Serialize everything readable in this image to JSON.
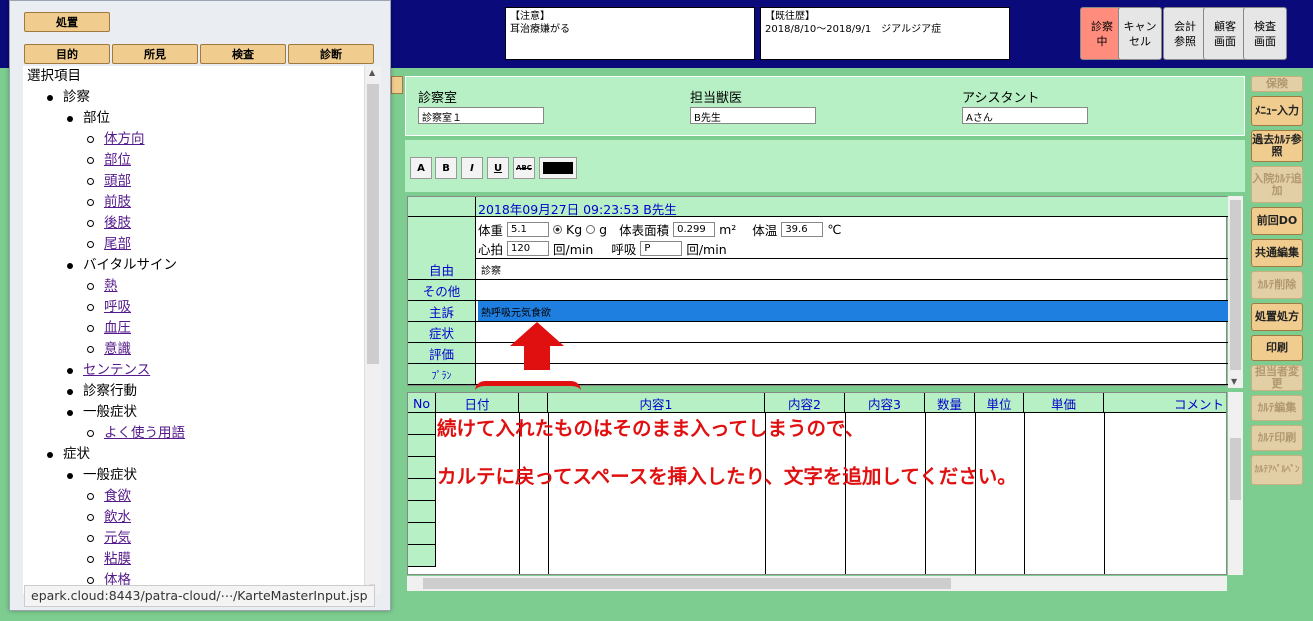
{
  "top": {
    "notice_label": "【注意】",
    "notice_text": "耳治療嫌がる",
    "history_label": "【既往歴】",
    "history_text": "2018/8/10～2018/9/1　ジアルジア症",
    "buttons": [
      "診察中",
      "キャンセル",
      "会計参照",
      "顧客画面",
      "検査画面"
    ]
  },
  "panel": {
    "top_button": "処置",
    "tabs": [
      "目的",
      "所見",
      "検査",
      "診断"
    ],
    "tree_root": "選択項目",
    "tree": [
      {
        "level": 1,
        "bullet": "dot",
        "label": "診察",
        "link": false
      },
      {
        "level": 2,
        "bullet": "dot",
        "label": "部位",
        "link": false
      },
      {
        "level": 3,
        "bullet": "circ",
        "label": "体方向",
        "link": true
      },
      {
        "level": 3,
        "bullet": "circ",
        "label": "部位",
        "link": true
      },
      {
        "level": 3,
        "bullet": "circ",
        "label": "頭部",
        "link": true
      },
      {
        "level": 3,
        "bullet": "circ",
        "label": "前肢",
        "link": true
      },
      {
        "level": 3,
        "bullet": "circ",
        "label": "後肢",
        "link": true
      },
      {
        "level": 3,
        "bullet": "circ",
        "label": "尾部",
        "link": true
      },
      {
        "level": 2,
        "bullet": "dot",
        "label": "バイタルサイン",
        "link": false
      },
      {
        "level": 3,
        "bullet": "circ",
        "label": "熱",
        "link": true
      },
      {
        "level": 3,
        "bullet": "circ",
        "label": "呼吸",
        "link": true
      },
      {
        "level": 3,
        "bullet": "circ",
        "label": "血圧",
        "link": true
      },
      {
        "level": 3,
        "bullet": "circ",
        "label": "意識",
        "link": true
      },
      {
        "level": 2,
        "bullet": "dot",
        "label": "センテンス",
        "link": true
      },
      {
        "level": 2,
        "bullet": "dot",
        "label": "診察行動",
        "link": false
      },
      {
        "level": 2,
        "bullet": "dot",
        "label": "一般症状",
        "link": false
      },
      {
        "level": 3,
        "bullet": "circ",
        "label": "よく使う用語",
        "link": true
      },
      {
        "level": 1,
        "bullet": "dot",
        "label": "症状",
        "link": false
      },
      {
        "level": 2,
        "bullet": "dot",
        "label": "一般症状",
        "link": false
      },
      {
        "level": 3,
        "bullet": "circ",
        "label": "食欲",
        "link": true
      },
      {
        "level": 3,
        "bullet": "circ",
        "label": "飲水",
        "link": true
      },
      {
        "level": 3,
        "bullet": "circ",
        "label": "元気",
        "link": true
      },
      {
        "level": 3,
        "bullet": "circ",
        "label": "粘膜",
        "link": true
      },
      {
        "level": 3,
        "bullet": "circ",
        "label": "体格",
        "link": true
      }
    ],
    "status_url": "epark.cloud:8443/patra-cloud/⋯/KarteMasterInput.jsp"
  },
  "form": {
    "room_label": "診察室",
    "room_value": "診察室１",
    "doctor_label": "担当獣医",
    "doctor_value": "B先生",
    "assistant_label": "アシスタント",
    "assistant_value": "Aさん"
  },
  "format_buttons": [
    "A",
    "B",
    "I",
    "U",
    "ABC"
  ],
  "karte": {
    "header": "2018年09月27日 09:23:53 B先生",
    "weight_label": "体重",
    "weight_value": "5.1",
    "unit_kg": "Kg",
    "unit_g": "g",
    "bsa_label": "体表面積",
    "bsa_value": "0.299",
    "bsa_unit": "m²",
    "temp_label": "体温",
    "temp_value": "39.6",
    "temp_unit": "℃",
    "pulse_label": "心拍",
    "pulse_value": "120",
    "pulse_unit": "回/min",
    "resp_label": "呼吸",
    "resp_value": "P",
    "resp_unit": "回/min",
    "rows": [
      {
        "label": "自由",
        "value": "診察"
      },
      {
        "label": "その他",
        "value": ""
      },
      {
        "label": "主訴",
        "value": "熱呼吸元気食欲"
      },
      {
        "label": "症状",
        "value": ""
      },
      {
        "label": "評価",
        "value": ""
      },
      {
        "label": "ﾌﾟﾗﾝ",
        "value": ""
      }
    ]
  },
  "grid_headers": [
    "No",
    "日付",
    "",
    "内容1",
    "内容2",
    "内容3",
    "数量",
    "単位",
    "単価",
    "コメント"
  ],
  "annotation": {
    "line1": "続けて入れたものはそのまま入ってしまうので、",
    "line2": "カルテに戻ってスペースを挿入したり、文字を追加してください。"
  },
  "side_buttons": [
    {
      "label": "保険",
      "dim": true
    },
    {
      "label": "ﾒﾆｭｰ入力",
      "dim": false
    },
    {
      "label": "過去ｶﾙﾃ参照",
      "dim": false
    },
    {
      "label": "入院ｶﾙﾃ追加",
      "dim": true
    },
    {
      "label": "前回DO",
      "dim": false
    },
    {
      "label": "共通編集",
      "dim": false
    },
    {
      "label": "ｶﾙﾃ削除",
      "dim": true
    },
    {
      "label": "処置処方",
      "dim": false
    },
    {
      "label": "印刷",
      "dim": false
    },
    {
      "label": "担当者変更",
      "dim": true
    },
    {
      "label": "ｶﾙﾃ編集",
      "dim": true
    },
    {
      "label": "ｶﾙﾃ印刷",
      "dim": true
    },
    {
      "label": "ｶﾙﾃｱﾍﾟﾙﾍﾟﾝ",
      "dim": true
    }
  ],
  "colors": {
    "accent_blue": "#0a0a7a",
    "panel_green": "#b8f0c5",
    "annotation_red": "#e01010",
    "selected_row": "#1e7fe0"
  }
}
